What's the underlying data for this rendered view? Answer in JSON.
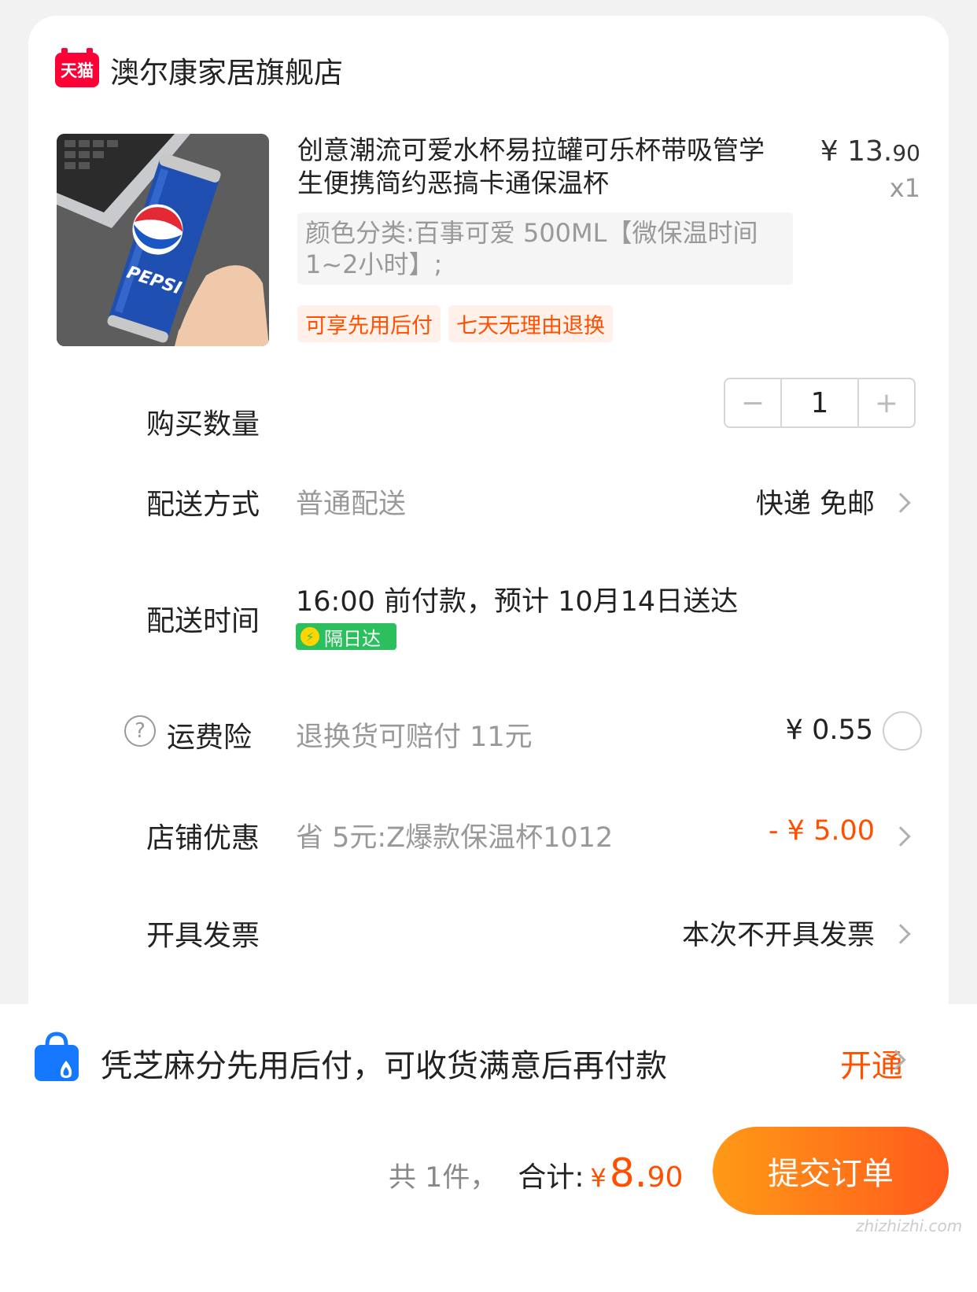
{
  "shop": {
    "badge": "天猫",
    "name": "澳尔康家居旗舰店"
  },
  "product": {
    "title": "创意潮流可爱水杯易拉罐可乐杯带吸管学生便携简约恶搞卡通保温杯",
    "price_symbol": "¥",
    "price_int": "13.",
    "price_dec": "90",
    "qty": "x1",
    "sku": "颜色分类:百事可爱 500ML【微保温时间1~2小时】;",
    "tags": [
      "可享先用后付",
      "七天无理由退换"
    ],
    "image_brand": "PEPSI"
  },
  "quantity": {
    "label": "购买数量",
    "minus": "−",
    "value": "1",
    "plus": "+"
  },
  "delivery": {
    "label": "配送方式",
    "method": "普通配送",
    "value": "快递 免邮"
  },
  "delivery_time": {
    "label": "配送时间",
    "text": "16:00 前付款，预计 10月14日送达",
    "badge": "隔日达"
  },
  "insurance": {
    "label": "运费险",
    "desc": "退换货可赔付 11元",
    "price": "¥ 0.55"
  },
  "store_discount": {
    "label": "店铺优惠",
    "desc": "省 5元:Z爆款保温杯1012",
    "value": "- ¥ 5.00"
  },
  "invoice": {
    "label": "开具发票",
    "value": "本次不开具发票"
  },
  "pay_later": {
    "text": "凭芝麻分先用后付，可收货满意后再付款",
    "action": "开通"
  },
  "summary": {
    "count_text": "共 1件，",
    "total_label": "合计:",
    "currency": "¥",
    "total_int": "8.",
    "total_dec": "90",
    "submit": "提交订单"
  },
  "watermark": "zhizhizhi.com",
  "colors": {
    "accent": "#ff5000",
    "tmall_red": "#ff0036",
    "nextday_green": "#2cbf5e"
  }
}
